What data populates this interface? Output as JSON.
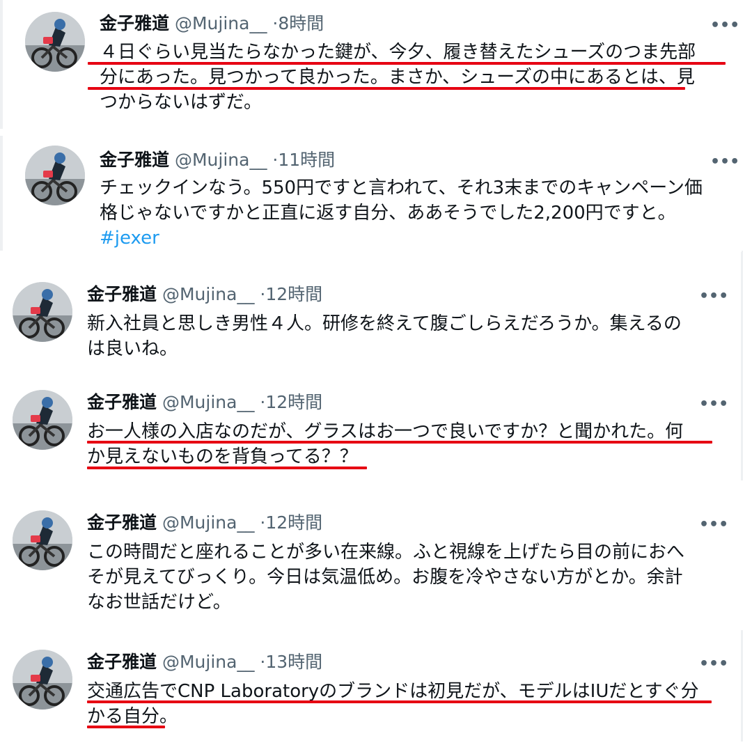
{
  "colors": {
    "text": "#0f1419",
    "secondary": "#536471",
    "link": "#1d9bf0",
    "underline": "#e60012"
  },
  "more_icon": "more-horizontal-icon",
  "tweets": [
    {
      "name": "金子雅道",
      "handle": "@Mujina__",
      "dot": "·",
      "time": "8時間",
      "lines": [
        "４日ぐらい見当たらなかった鍵が、今夕、履き替えたシューズのつま先部",
        "分にあった。見つかって良かった。まさか、シューズの中にあるとは、見",
        "つからないはずだ。"
      ]
    },
    {
      "name": "金子雅道",
      "handle": "@Mujina__",
      "dot": "·",
      "time": "11時間",
      "lines": [
        "チェックインなう。550円ですと言われて、それ3末までのキャンペーン価",
        "格じゃないですかと正直に返す自分、ああそうでした2,200円ですと。"
      ],
      "hashtag": "#jexer"
    },
    {
      "name": "金子雅道",
      "handle": "@Mujina__",
      "dot": "·",
      "time": "12時間",
      "lines": [
        "新入社員と思しき男性４人。研修を終えて腹ごしらえだろうか。集えるの",
        "は良いね。"
      ]
    },
    {
      "name": "金子雅道",
      "handle": "@Mujina__",
      "dot": "·",
      "time": "12時間",
      "lines": [
        "お一人様の入店なのだが、グラスはお一つで良いですか？と聞かれた。何",
        "か見えないものを背負ってる？？"
      ]
    },
    {
      "name": "金子雅道",
      "handle": "@Mujina__",
      "dot": "·",
      "time": "12時間",
      "lines": [
        "この時間だと座れることが多い在来線。ふと視線を上げたら目の前におへ",
        "そが見えてびっくり。今日は気温低め。お腹を冷やさない方がとか。余計",
        "なお世話だけど。"
      ]
    },
    {
      "name": "金子雅道",
      "handle": "@Mujina__",
      "dot": "·",
      "time": "13時間",
      "lines": [
        "交通広告でCNP Laboratoryのブランドは初見だが、モデルはIUだとすぐ分",
        "かる自分。"
      ]
    }
  ]
}
